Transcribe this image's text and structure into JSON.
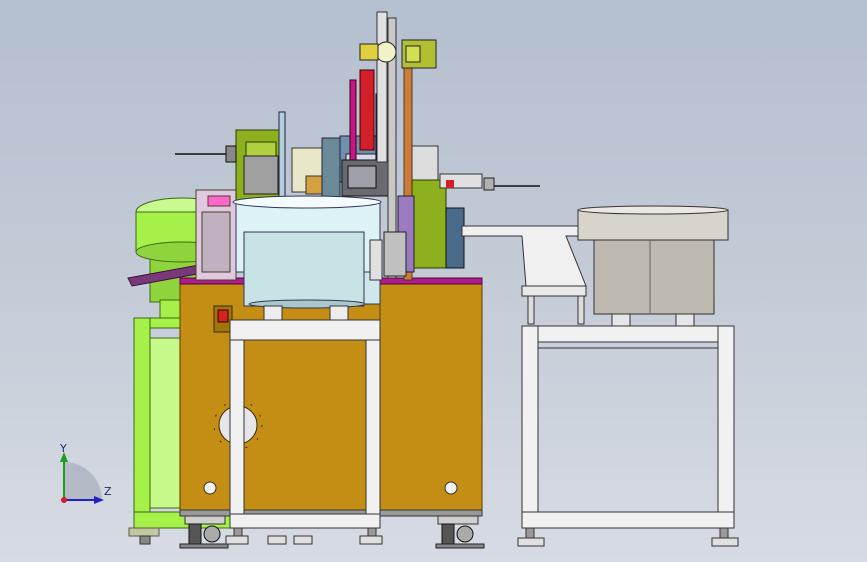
{
  "view": {
    "triad": {
      "y_label": "Y",
      "z_label": "Z"
    }
  },
  "colors": {
    "background_top": "#b4bfcf",
    "background_bottom": "#d7dbe3",
    "cabinet": "#c48d14",
    "bowl_feeder_left": "#a6f04a",
    "bowl_feeder_center": "#e6f6f8",
    "bowl_feeder_right": "#bdb8b0",
    "frame_white": "#f1f1f1",
    "accent_magenta": "#c0188c",
    "accent_red": "#d21f2a",
    "accent_olive": "#8cb01e"
  },
  "icons": {
    "triad": "coordinate-triad-icon"
  }
}
